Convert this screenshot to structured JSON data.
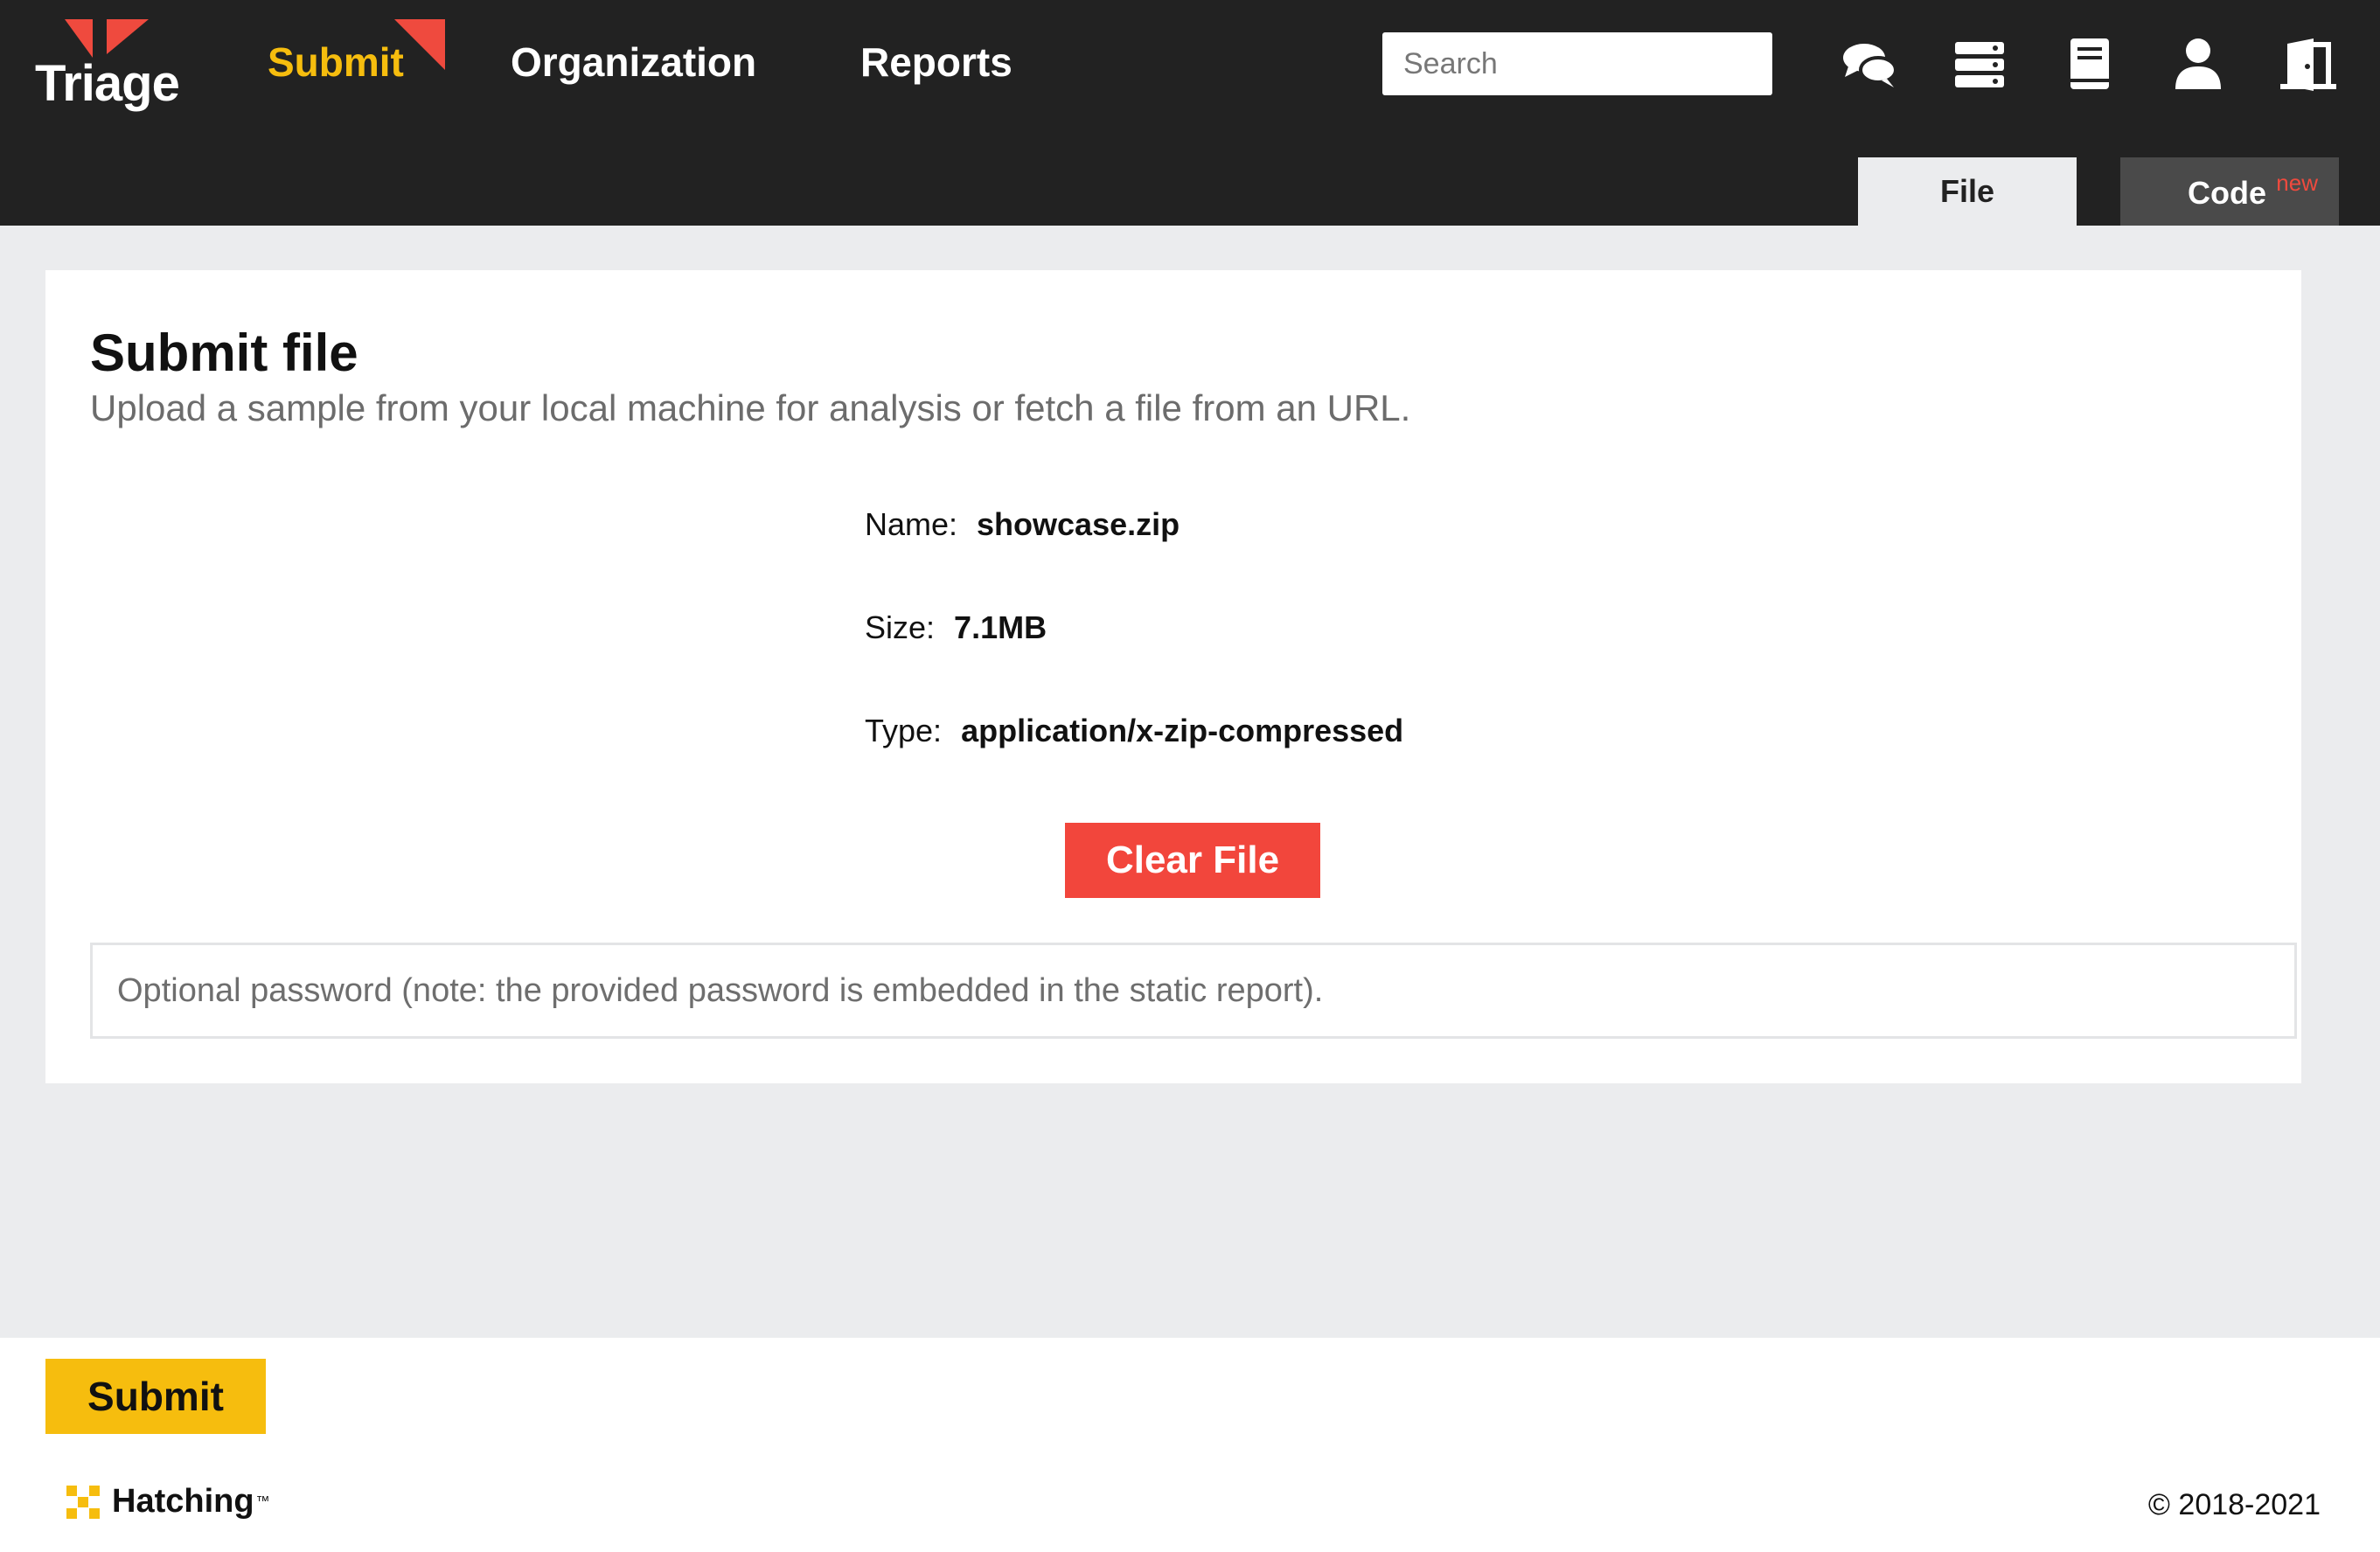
{
  "header": {
    "logo_text": "Triage",
    "nav": [
      {
        "label": "Submit",
        "active": true
      },
      {
        "label": "Organization",
        "active": false
      },
      {
        "label": "Reports",
        "active": false
      }
    ],
    "search_placeholder": "Search",
    "icons": [
      "chat-icon",
      "server-icon",
      "docs-book-icon",
      "user-icon",
      "logout-door-icon"
    ],
    "tabs": [
      {
        "label": "File",
        "active": true
      },
      {
        "label": "Code",
        "badge": "new",
        "active": false
      }
    ]
  },
  "card": {
    "title": "Submit file",
    "subtitle": "Upload a sample from your local machine for analysis or fetch a file from an URL.",
    "file": {
      "name_label": "Name:",
      "name_value": "showcase.zip",
      "size_label": "Size:",
      "size_value": "7.1MB",
      "type_label": "Type:",
      "type_value": "application/x-zip-compressed"
    },
    "clear_button": "Clear File",
    "password_placeholder": "Optional password (note: the provided password is embedded in the static report)."
  },
  "footer": {
    "submit_button": "Submit",
    "brand": "Hatching",
    "brand_tm": "™",
    "copyright": "© 2018-2021"
  },
  "colors": {
    "header_bg": "#222222",
    "accent_yellow": "#f6bd0e",
    "accent_red": "#f2463c",
    "page_bg": "#ebecee"
  }
}
